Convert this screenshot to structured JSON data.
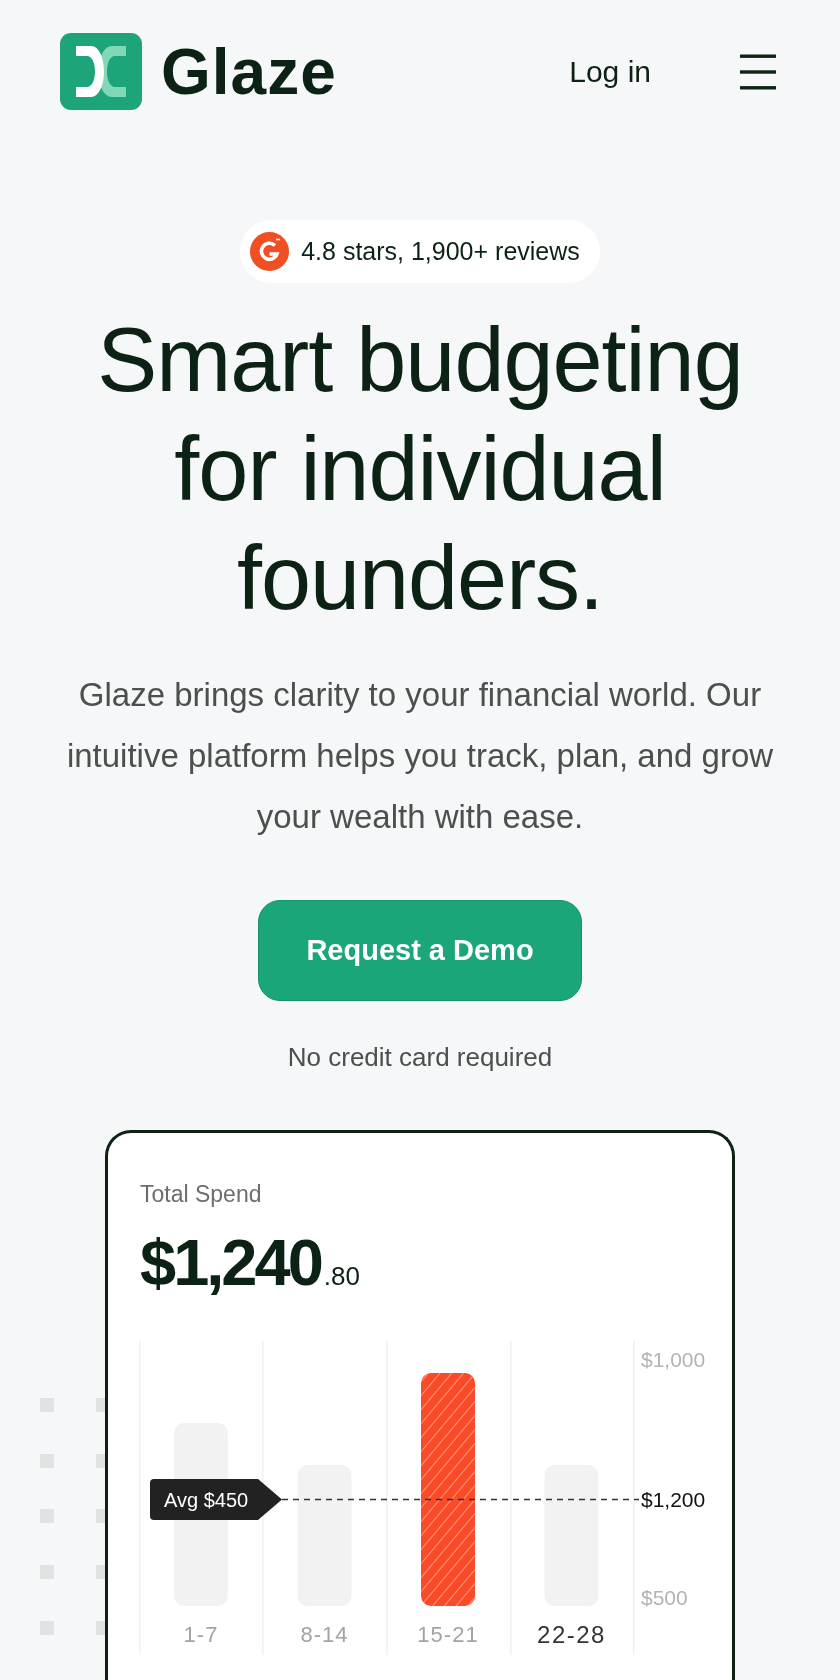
{
  "header": {
    "logo_text": "Glaze",
    "login": "Log in"
  },
  "hero": {
    "rating_badge": "4.8 stars, 1,900+ reviews",
    "headline": "Smart budgeting for individual founders.",
    "description": "Glaze brings clarity to your financial world. Our intuitive platform helps you track, plan, and grow your wealth with ease.",
    "cta_button": "Request a Demo",
    "cta_note": "No credit card required"
  },
  "spend_card": {
    "title": "Total Spend",
    "amount": "$1,240",
    "amount_cents": ".80",
    "chart": {
      "axis_top": "$1,000",
      "average_tag": "Avg $450",
      "average_value": "$1,200",
      "axis_bottom": "$500",
      "weeks": [
        {
          "label": "1-7",
          "highlighted": false,
          "current": false
        },
        {
          "label": "8-14",
          "highlighted": false,
          "current": false
        },
        {
          "label": "15-21",
          "highlighted": true,
          "current": false
        },
        {
          "label": "22-28",
          "highlighted": false,
          "current": true
        }
      ]
    }
  }
}
